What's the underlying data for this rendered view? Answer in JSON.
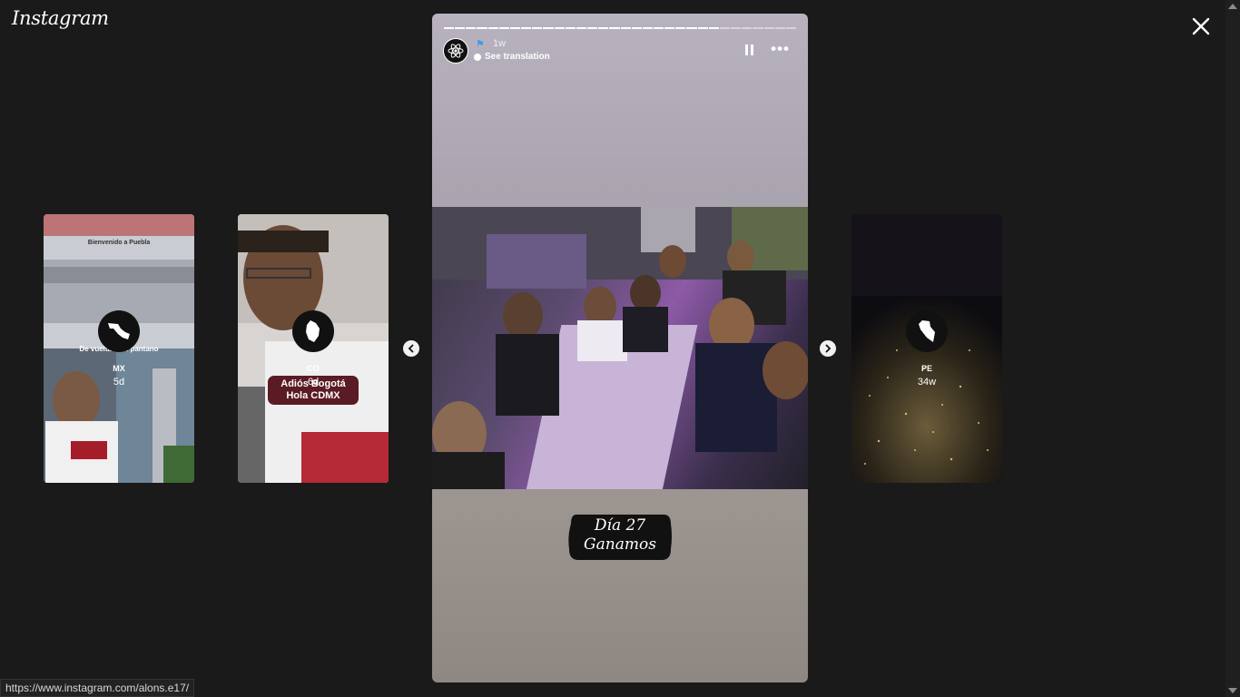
{
  "app": {
    "logo": "Instagram"
  },
  "stories": [
    {
      "name": "MX",
      "time": "5d",
      "caption": "De vuelta a mi pantano",
      "top_text": "Bienvenido a Puebla"
    },
    {
      "name": "CO",
      "time": "6d",
      "caption_line1": "Adiós Bogotá",
      "caption_line2": "Hola CDMX"
    },
    {
      "name": "PE",
      "time": "34w"
    }
  ],
  "current": {
    "time": "1w",
    "translate": "See translation",
    "sticker_line1": "Día 27",
    "sticker_line2": "Ganamos",
    "segments_total": 32,
    "segments_done": 25
  },
  "status": {
    "url": "https://www.instagram.com/alons.e17/"
  }
}
